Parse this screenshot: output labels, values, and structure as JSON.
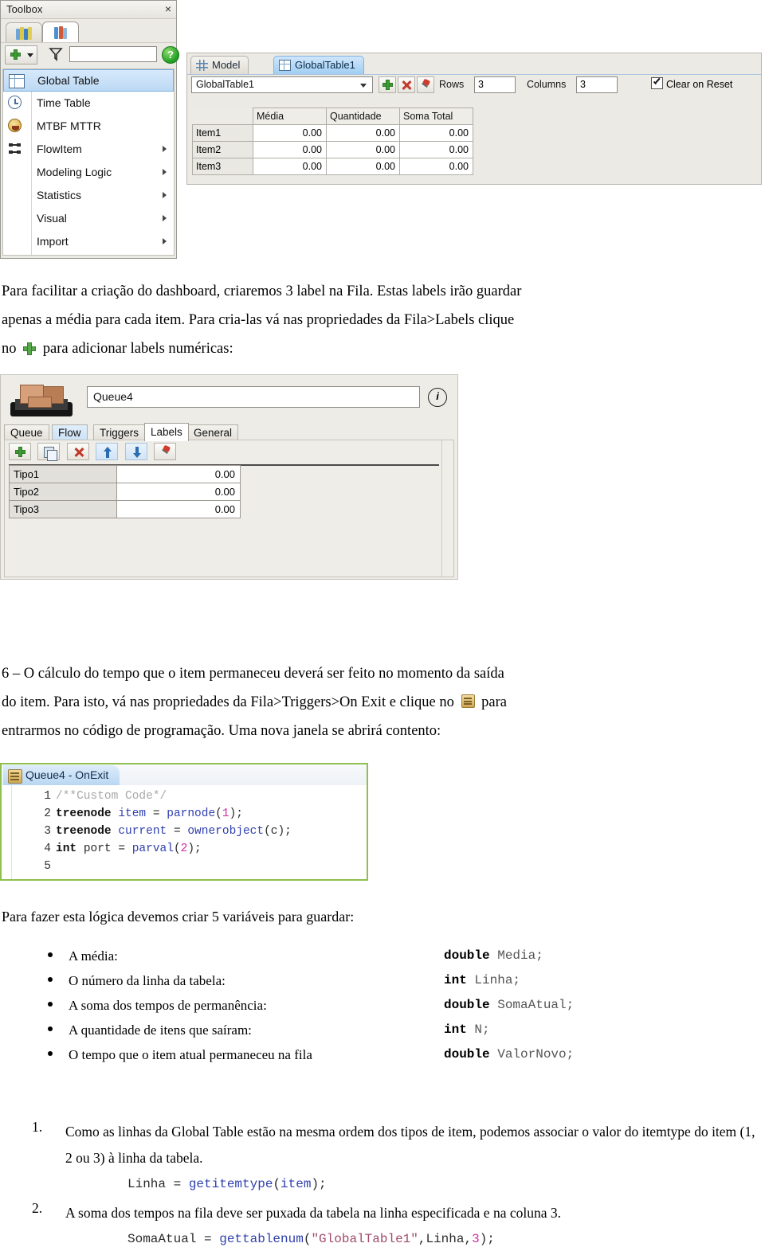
{
  "toolbox": {
    "title": "Toolbox",
    "close_label": "×",
    "tabs": [
      {
        "name": "tab-library",
        "icon": "people-icon"
      },
      {
        "name": "tab-toolbox",
        "icon": "people-tools-icon"
      }
    ],
    "toolbar": {
      "add_label": "",
      "dropdown_caret": "",
      "filter_icon": "funnel-icon",
      "search_value": "",
      "search_placeholder": "",
      "help_label": "?"
    },
    "items": [
      {
        "label": "Global Table",
        "icon": "grid-icon",
        "has_submenu": false,
        "selected": true
      },
      {
        "label": "Time Table",
        "icon": "clock-icon",
        "has_submenu": false,
        "selected": false
      },
      {
        "label": "MTBF MTTR",
        "icon": "gauge-icon",
        "has_submenu": false,
        "selected": false
      },
      {
        "label": "FlowItem",
        "icon": "flow-icon",
        "has_submenu": true,
        "selected": false
      },
      {
        "label": "Modeling Logic",
        "icon": "",
        "has_submenu": true,
        "selected": false
      },
      {
        "label": "Statistics",
        "icon": "",
        "has_submenu": true,
        "selected": false
      },
      {
        "label": "Visual",
        "icon": "",
        "has_submenu": true,
        "selected": false
      },
      {
        "label": "Import",
        "icon": "",
        "has_submenu": true,
        "selected": false
      }
    ]
  },
  "global_table": {
    "tabs": [
      {
        "label": "Model",
        "icon": "model-grid-icon",
        "selected": false
      },
      {
        "label": "GlobalTable1",
        "icon": "table-icon",
        "selected": true
      }
    ],
    "selected_table": "GlobalTable1",
    "add_button": "",
    "delete_button": "",
    "pin_button": "",
    "rows_label": "Rows",
    "rows_value": "3",
    "columns_label": "Columns",
    "columns_value": "3",
    "clear_on_reset_label": "Clear on Reset",
    "clear_on_reset_checked": true,
    "column_headers": [
      "",
      "Média",
      "Quantidade",
      "Soma Total"
    ],
    "rows": [
      {
        "header": "Item1",
        "values": [
          "0.00",
          "0.00",
          "0.00"
        ]
      },
      {
        "header": "Item2",
        "values": [
          "0.00",
          "0.00",
          "0.00"
        ]
      },
      {
        "header": "Item3",
        "values": [
          "0.00",
          "0.00",
          "0.00"
        ]
      }
    ]
  },
  "paragraph_1": {
    "line1": "Para facilitar a criação do dashboard, criaremos 3 label na Fila. Estas labels irão guardar",
    "line2": "apenas a média para cada item. Para cria-las vá nas propriedades da Fila>Labels clique",
    "line3_before": "no",
    "line3_icon": "green-plus-icon",
    "line3_after": "para adicionar labels numéricas:"
  },
  "queue_props": {
    "object_icon": "pallet-box-icon",
    "name_value": "Queue4",
    "info_button": "i",
    "tabs": [
      {
        "label": "Queue",
        "selected": false
      },
      {
        "label": "Flow",
        "selected": false,
        "style": "blue"
      },
      {
        "label": "Triggers",
        "selected": false
      },
      {
        "label": "Labels",
        "selected": true
      },
      {
        "label": "General",
        "selected": false
      }
    ],
    "toolbar_buttons": [
      {
        "name": "add-label-button",
        "icon": "green-plus-icon"
      },
      {
        "name": "duplicate-label-button",
        "icon": "copy-icon"
      },
      {
        "name": "delete-label-button",
        "icon": "red-x-icon"
      },
      {
        "name": "move-up-button",
        "icon": "arrow-up-icon"
      },
      {
        "name": "move-down-button",
        "icon": "arrow-down-icon"
      },
      {
        "name": "pin-button",
        "icon": "pin-icon"
      }
    ],
    "labels": [
      {
        "name": "Tipo1",
        "value": "0.00"
      },
      {
        "name": "Tipo2",
        "value": "0.00"
      },
      {
        "name": "Tipo3",
        "value": "0.00"
      }
    ]
  },
  "paragraph_2": {
    "line1": "6 – O cálculo do tempo que o item permaneceu deverá ser feito no momento da saída",
    "line2_a": "do item. Para isto, vá nas propriedades da Fila>Triggers>On Exit e clique no",
    "line2_icon": "script-scroll-icon",
    "line2_b": "para",
    "line3": "entrarmos no código de programação. Uma nova janela se abrirá contento:"
  },
  "code_window": {
    "tab_icon": "script-scroll-icon",
    "tab_title": "Queue4 - OnExit",
    "lines": [
      {
        "n": "1",
        "tokens": [
          {
            "t": "/**Custom Code*/",
            "c": "cmt"
          }
        ]
      },
      {
        "n": "2",
        "tokens": [
          {
            "t": "treenode",
            "c": "type"
          },
          {
            "t": " ",
            "c": "plain"
          },
          {
            "t": "item",
            "c": "blue"
          },
          {
            "t": " = ",
            "c": "plain"
          },
          {
            "t": "parnode",
            "c": "fn"
          },
          {
            "t": "(",
            "c": "plain"
          },
          {
            "t": "1",
            "c": "num"
          },
          {
            "t": ");",
            "c": "plain"
          }
        ]
      },
      {
        "n": "3",
        "tokens": [
          {
            "t": "treenode",
            "c": "type"
          },
          {
            "t": " ",
            "c": "plain"
          },
          {
            "t": "current",
            "c": "blue"
          },
          {
            "t": " = ",
            "c": "plain"
          },
          {
            "t": "ownerobject",
            "c": "fn"
          },
          {
            "t": "(c);",
            "c": "plain"
          }
        ]
      },
      {
        "n": "4",
        "tokens": [
          {
            "t": "int",
            "c": "type"
          },
          {
            "t": " ",
            "c": "plain"
          },
          {
            "t": "port",
            "c": "plain"
          },
          {
            "t": " = ",
            "c": "plain"
          },
          {
            "t": "parval",
            "c": "fn"
          },
          {
            "t": "(",
            "c": "plain"
          },
          {
            "t": "2",
            "c": "num"
          },
          {
            "t": ");",
            "c": "plain"
          }
        ]
      },
      {
        "n": "5",
        "tokens": []
      }
    ]
  },
  "variables_section": {
    "intro": "Para fazer esta lógica devemos criar 5 variáveis para guardar:",
    "items": [
      {
        "label": "A média:",
        "type": "double",
        "decl": " Media;"
      },
      {
        "label": "O número da linha da tabela:",
        "type": "int",
        "decl": " Linha;"
      },
      {
        "label": "A soma dos tempos de permanência:",
        "type": "double",
        "decl": " SomaAtual;"
      },
      {
        "label": "A quantidade de itens que saíram:",
        "type": "int",
        "decl": " N;"
      },
      {
        "label": "O tempo que o item atual permaneceu na fila",
        "type": "double",
        "decl": " ValorNovo;"
      }
    ]
  },
  "numbered_list": [
    {
      "num": "1.",
      "text": "Como as linhas da Global Table estão na mesma ordem dos tipos de item, podemos associar o valor do itemtype do item (1, 2 ou 3) à linha da tabela.",
      "code_tokens": [
        {
          "t": "Linha = ",
          "c": "plain"
        },
        {
          "t": "getitemtype",
          "c": "fn"
        },
        {
          "t": "(",
          "c": "plain"
        },
        {
          "t": "item",
          "c": "blue"
        },
        {
          "t": ");",
          "c": "plain"
        }
      ]
    },
    {
      "num": "2.",
      "text": "A soma dos tempos na fila deve ser puxada da tabela na linha especificada e na coluna 3.",
      "code_tokens": [
        {
          "t": "SomaAtual = ",
          "c": "plain"
        },
        {
          "t": "gettablenum",
          "c": "fn"
        },
        {
          "t": "(",
          "c": "plain"
        },
        {
          "t": "\"GlobalTable1\"",
          "c": "str"
        },
        {
          "t": ",Linha,",
          "c": "plain"
        },
        {
          "t": "3",
          "c": "num"
        },
        {
          "t": ");",
          "c": "plain"
        }
      ]
    }
  ],
  "colors": {
    "accent_blue": "#9fcdf2",
    "green_plus": "#3f9c35",
    "red_x": "#c0392b",
    "code_fn": "#2f3fae",
    "code_num": "#cc2fa0",
    "code_str": "#a04a6b",
    "code_comment": "#a8a8a8",
    "panel_bg": "#eceae4"
  }
}
